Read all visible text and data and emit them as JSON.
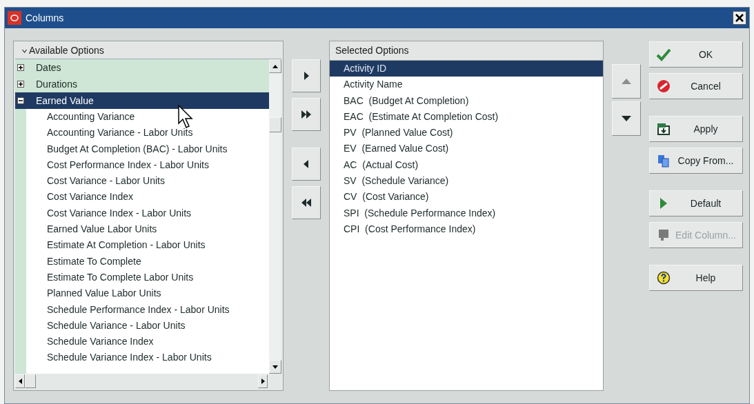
{
  "window": {
    "title": "Columns"
  },
  "available_options": {
    "header": "Available Options",
    "items": [
      {
        "label": "Dates",
        "expanded": false,
        "selected": false
      },
      {
        "label": "Durations",
        "expanded": false,
        "selected": false
      },
      {
        "label": "Earned Value",
        "expanded": true,
        "selected": true,
        "children": [
          {
            "label": "Accounting Variance"
          },
          {
            "label": "Accounting Variance - Labor Units"
          },
          {
            "label": "Budget At Completion (BAC) - Labor Units"
          },
          {
            "label": "Cost Performance Index - Labor Units"
          },
          {
            "label": "Cost Variance - Labor Units"
          },
          {
            "label": "Cost Variance Index"
          },
          {
            "label": "Cost Variance Index - Labor Units"
          },
          {
            "label": "Earned Value Labor Units"
          },
          {
            "label": "Estimate At Completion - Labor Units"
          },
          {
            "label": "Estimate To Complete"
          },
          {
            "label": "Estimate To Complete Labor Units"
          },
          {
            "label": "Planned Value Labor Units"
          },
          {
            "label": "Schedule Performance Index - Labor Units"
          },
          {
            "label": "Schedule Variance - Labor Units"
          },
          {
            "label": "Schedule Variance Index"
          },
          {
            "label": "Schedule Variance Index - Labor Units"
          }
        ]
      }
    ]
  },
  "selected_options": {
    "header": "Selected Options",
    "items": [
      {
        "label": "Activity ID",
        "selected": true
      },
      {
        "label": "Activity Name",
        "selected": false
      },
      {
        "label": "BAC  (Budget At Completion)",
        "selected": false
      },
      {
        "label": "EAC  (Estimate At Completion Cost)",
        "selected": false
      },
      {
        "label": "PV  (Planned Value Cost)",
        "selected": false
      },
      {
        "label": "EV  (Earned Value Cost)",
        "selected": false
      },
      {
        "label": "AC  (Actual Cost)",
        "selected": false
      },
      {
        "label": "SV  (Schedule Variance)",
        "selected": false
      },
      {
        "label": "CV  (Cost Variance)",
        "selected": false
      },
      {
        "label": "SPI  (Schedule Performance Index)",
        "selected": false
      },
      {
        "label": "CPI  (Cost Performance Index)",
        "selected": false
      }
    ]
  },
  "move_buttons": [
    {
      "kind": "add"
    },
    {
      "kind": "add_all"
    },
    {
      "kind": "remove"
    },
    {
      "kind": "remove_all"
    }
  ],
  "order_buttons": [
    {
      "kind": "up",
      "disabled": true
    },
    {
      "kind": "down",
      "disabled": false
    }
  ],
  "actions": [
    {
      "kind": "ok",
      "label": "OK",
      "disabled": false
    },
    {
      "kind": "cancel",
      "label": "Cancel",
      "disabled": false
    },
    {
      "kind": "apply",
      "label": "Apply",
      "disabled": false
    },
    {
      "kind": "copy",
      "label": "Copy From...",
      "disabled": false
    },
    {
      "kind": "default",
      "label": "Default",
      "disabled": false
    },
    {
      "kind": "edit",
      "label": "Edit Column...",
      "disabled": true
    },
    {
      "kind": "help",
      "label": "Help",
      "disabled": false
    }
  ]
}
